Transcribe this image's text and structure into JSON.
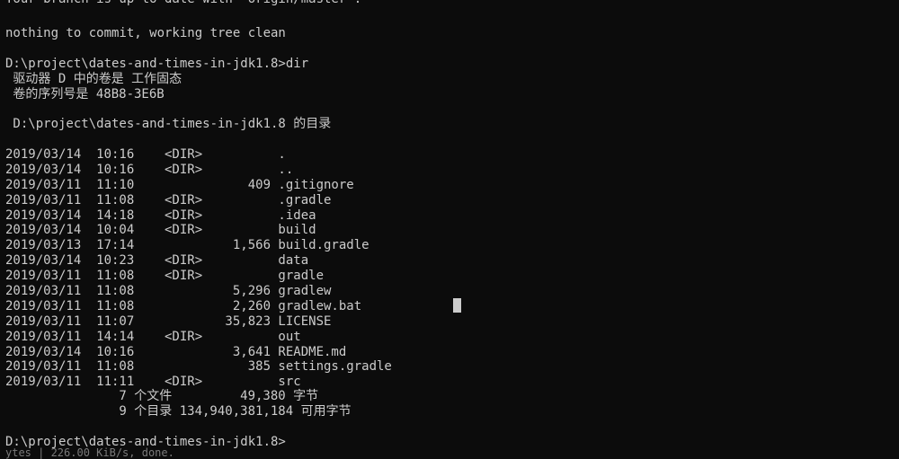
{
  "terminal": {
    "top_partial": "Your branch is up to date with 'origin/master'.",
    "line_commit": "nothing to commit, working tree clean",
    "prompt_1": "D:\\project\\dates-and-times-in-jdk1.8>dir",
    "volume_line": " 驱动器 D 中的卷是 工作固态",
    "serial_line": " 卷的序列号是 48B8-3E6B",
    "dir_of_line": " D:\\project\\dates-and-times-in-jdk1.8 的目录",
    "entries": [
      "2019/03/14  10:16    <DIR>          .",
      "2019/03/14  10:16    <DIR>          ..",
      "2019/03/11  11:10               409 .gitignore",
      "2019/03/11  11:08    <DIR>          .gradle",
      "2019/03/14  14:18    <DIR>          .idea",
      "2019/03/14  10:04    <DIR>          build",
      "2019/03/13  17:14             1,566 build.gradle",
      "2019/03/14  10:23    <DIR>          data",
      "2019/03/11  11:08    <DIR>          gradle",
      "2019/03/11  11:08             5,296 gradlew",
      "2019/03/11  11:08             2,260 gradlew.bat",
      "2019/03/11  11:07            35,823 LICENSE",
      "2019/03/11  14:14    <DIR>          out",
      "2019/03/14  10:16             3,641 README.md",
      "2019/03/11  11:08               385 settings.gradle",
      "2019/03/11  11:11    <DIR>          src"
    ],
    "summary_files": "               7 个文件         49,380 字节",
    "summary_dirs": "               9 个目录 134,940,381,184 可用字节",
    "prompt_2": "D:\\project\\dates-and-times-in-jdk1.8>",
    "bottom_partial": "ytes | 226.00 KiB/s, done."
  }
}
